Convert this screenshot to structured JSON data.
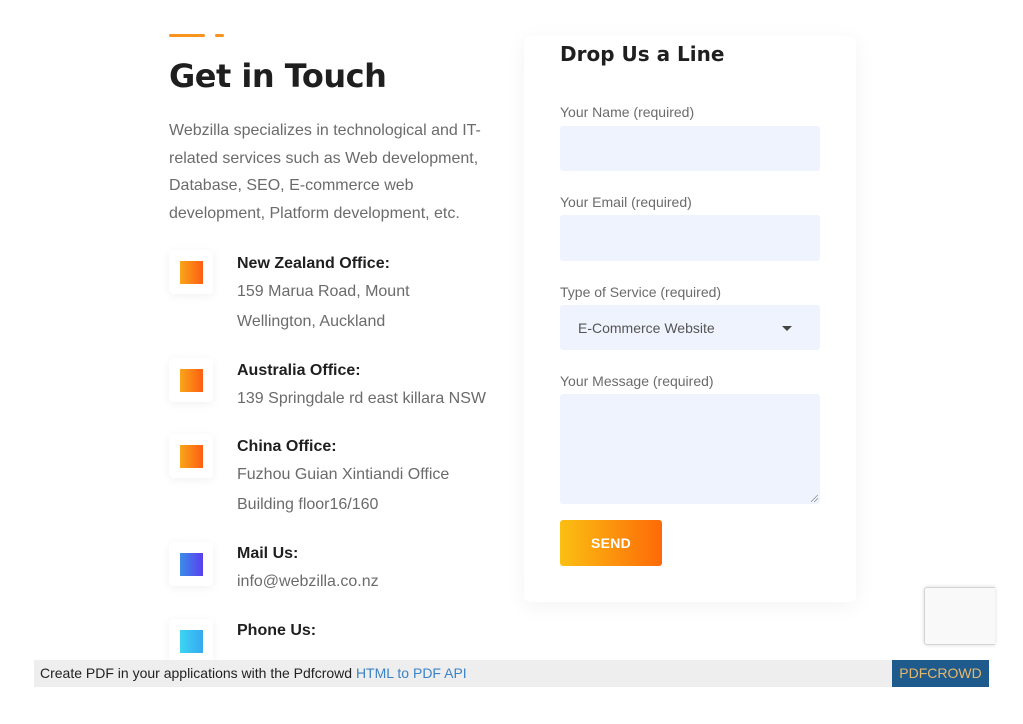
{
  "contact": {
    "heading": "Get in Touch",
    "intro": "Webzilla specializes in technological and IT-related services such as Web development, Database, SEO, E-commerce web development, Platform development, etc.",
    "offices": [
      {
        "title": "New Zealand Office:",
        "text": "159 Marua Road, Mount Wellington, Auckland",
        "icon": "location-icon",
        "color": "#fd6a08"
      },
      {
        "title": "Australia Office:",
        "text": "139 Springdale rd east killara NSW",
        "icon": "location-icon",
        "color": "#fd6a08"
      },
      {
        "title": "China Office:",
        "text": "Fuzhou Guian Xintiandi Office Building floor16/160",
        "icon": "location-icon",
        "color": "#fd6a08"
      },
      {
        "title": "Mail Us:",
        "text": "info@webzilla.co.nz",
        "icon": "mail-icon",
        "color": "#4a5cee"
      },
      {
        "title": "Phone Us:",
        "text": "",
        "icon": "phone-icon",
        "color": "#3cc8f3"
      }
    ]
  },
  "form": {
    "title": "Drop Us a Line",
    "name_label": "Your Name (required)",
    "name_value": "",
    "email_label": "Your Email (required)",
    "email_value": "",
    "service_label": "Type of Service (required)",
    "service_value": "E-Commerce Website",
    "message_label": "Your Message (required)",
    "message_value": "",
    "send_label": "SEND"
  },
  "footer": {
    "text": "Create PDF in your applications with the Pdfcrowd ",
    "link": "HTML to PDF API",
    "brand": "PDFCROWD"
  },
  "colors": {
    "accent": "#f7931e",
    "field_bg": "#eef3fd",
    "footer_brand_bg": "#1e5a8b"
  }
}
